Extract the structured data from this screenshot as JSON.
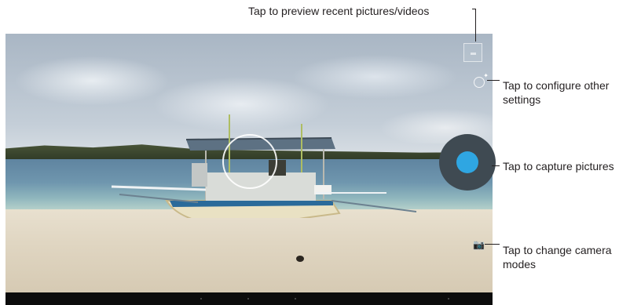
{
  "callouts": {
    "preview": "Tap to preview recent pictures/videos",
    "settings_line1": "Tap to configure other",
    "settings_line2": "settings",
    "capture": "Tap to capture pictures",
    "modes_line1": "Tap to change camera",
    "modes_line2": "modes"
  },
  "colors": {
    "shutter_accent": "#2fa6e2",
    "shutter_ring": "#3f4a52",
    "callout_text": "#231f20"
  },
  "icons": {
    "preview": "gallery-thumbnail-icon",
    "settings": "settings-icon",
    "capture": "shutter-icon",
    "modes": "camera-mode-icon"
  }
}
